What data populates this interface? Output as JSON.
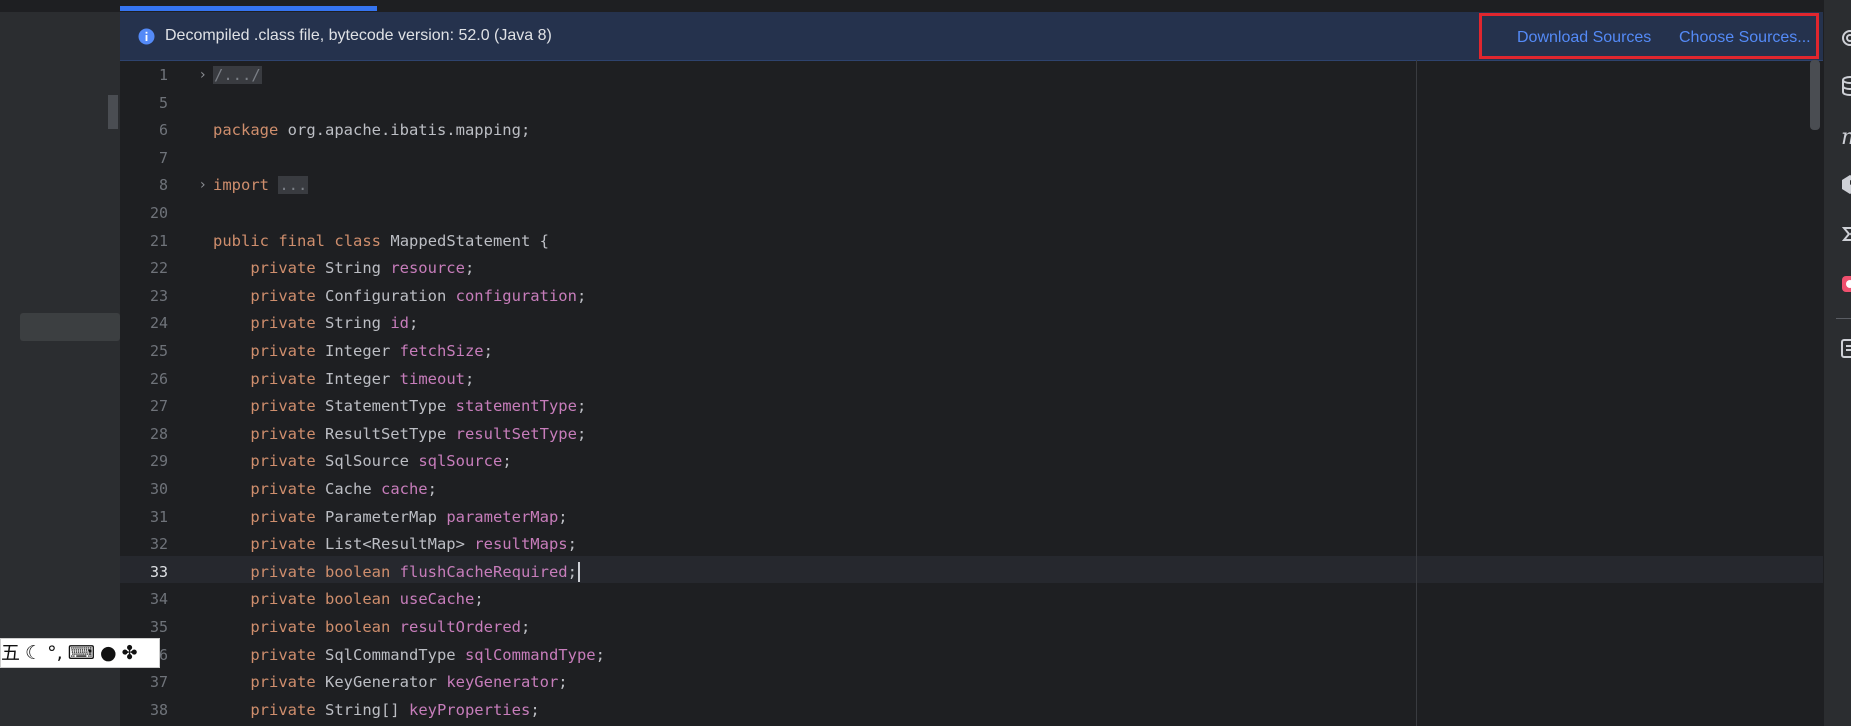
{
  "notification": {
    "message": "Decompiled .class file, bytecode version: 52.0 (Java 8)",
    "download_sources": "Download Sources",
    "choose_sources": "Choose Sources..."
  },
  "editor": {
    "current_line": "33",
    "lines": [
      {
        "n": "1",
        "fold": true,
        "tokens": [
          {
            "t": "/.../",
            "c": "fold-ph"
          }
        ]
      },
      {
        "n": "5",
        "tokens": []
      },
      {
        "n": "6",
        "tokens": [
          {
            "t": "package",
            "c": "kw"
          },
          {
            "t": " org.apache.ibatis.mapping;",
            "c": "tp"
          }
        ]
      },
      {
        "n": "7",
        "tokens": []
      },
      {
        "n": "8",
        "fold": true,
        "tokens": [
          {
            "t": "import",
            "c": "kw"
          },
          {
            "t": " ",
            "c": "tp"
          },
          {
            "t": "...",
            "c": "fold-ph"
          }
        ]
      },
      {
        "n": "20",
        "tokens": []
      },
      {
        "n": "21",
        "tokens": [
          {
            "t": "public",
            "c": "kw"
          },
          {
            "t": " ",
            "c": "tp"
          },
          {
            "t": "final",
            "c": "kw"
          },
          {
            "t": " ",
            "c": "tp"
          },
          {
            "t": "class",
            "c": "kw"
          },
          {
            "t": " MappedStatement {",
            "c": "tp"
          }
        ]
      },
      {
        "n": "22",
        "tokens": [
          {
            "t": "    private",
            "c": "kw"
          },
          {
            "t": " String ",
            "c": "tp"
          },
          {
            "t": "resource",
            "c": "fld"
          },
          {
            "t": ";",
            "c": "tp"
          }
        ]
      },
      {
        "n": "23",
        "tokens": [
          {
            "t": "    private",
            "c": "kw"
          },
          {
            "t": " Configuration ",
            "c": "tp"
          },
          {
            "t": "configuration",
            "c": "fld"
          },
          {
            "t": ";",
            "c": "tp"
          }
        ]
      },
      {
        "n": "24",
        "tokens": [
          {
            "t": "    private",
            "c": "kw"
          },
          {
            "t": " String ",
            "c": "tp"
          },
          {
            "t": "id",
            "c": "fld"
          },
          {
            "t": ";",
            "c": "tp"
          }
        ]
      },
      {
        "n": "25",
        "tokens": [
          {
            "t": "    private",
            "c": "kw"
          },
          {
            "t": " Integer ",
            "c": "tp"
          },
          {
            "t": "fetchSize",
            "c": "fld"
          },
          {
            "t": ";",
            "c": "tp"
          }
        ]
      },
      {
        "n": "26",
        "tokens": [
          {
            "t": "    private",
            "c": "kw"
          },
          {
            "t": " Integer ",
            "c": "tp"
          },
          {
            "t": "timeout",
            "c": "fld"
          },
          {
            "t": ";",
            "c": "tp"
          }
        ]
      },
      {
        "n": "27",
        "tokens": [
          {
            "t": "    private",
            "c": "kw"
          },
          {
            "t": " StatementType ",
            "c": "tp"
          },
          {
            "t": "statementType",
            "c": "fld"
          },
          {
            "t": ";",
            "c": "tp"
          }
        ]
      },
      {
        "n": "28",
        "tokens": [
          {
            "t": "    private",
            "c": "kw"
          },
          {
            "t": " ResultSetType ",
            "c": "tp"
          },
          {
            "t": "resultSetType",
            "c": "fld"
          },
          {
            "t": ";",
            "c": "tp"
          }
        ]
      },
      {
        "n": "29",
        "tokens": [
          {
            "t": "    private",
            "c": "kw"
          },
          {
            "t": " SqlSource ",
            "c": "tp"
          },
          {
            "t": "sqlSource",
            "c": "fld"
          },
          {
            "t": ";",
            "c": "tp"
          }
        ]
      },
      {
        "n": "30",
        "tokens": [
          {
            "t": "    private",
            "c": "kw"
          },
          {
            "t": " Cache ",
            "c": "tp"
          },
          {
            "t": "cache",
            "c": "fld"
          },
          {
            "t": ";",
            "c": "tp"
          }
        ]
      },
      {
        "n": "31",
        "tokens": [
          {
            "t": "    private",
            "c": "kw"
          },
          {
            "t": " ParameterMap ",
            "c": "tp"
          },
          {
            "t": "parameterMap",
            "c": "fld"
          },
          {
            "t": ";",
            "c": "tp"
          }
        ]
      },
      {
        "n": "32",
        "tokens": [
          {
            "t": "    private",
            "c": "kw"
          },
          {
            "t": " List<ResultMap> ",
            "c": "tp"
          },
          {
            "t": "resultMaps",
            "c": "fld"
          },
          {
            "t": ";",
            "c": "tp"
          }
        ]
      },
      {
        "n": "33",
        "caret": true,
        "tokens": [
          {
            "t": "    private",
            "c": "kw"
          },
          {
            "t": " ",
            "c": "tp"
          },
          {
            "t": "boolean",
            "c": "kw"
          },
          {
            "t": " ",
            "c": "tp"
          },
          {
            "t": "flushCacheRequired",
            "c": "fld"
          },
          {
            "t": ";",
            "c": "tp"
          }
        ]
      },
      {
        "n": "34",
        "tokens": [
          {
            "t": "    private",
            "c": "kw"
          },
          {
            "t": " ",
            "c": "tp"
          },
          {
            "t": "boolean",
            "c": "kw"
          },
          {
            "t": " ",
            "c": "tp"
          },
          {
            "t": "useCache",
            "c": "fld"
          },
          {
            "t": ";",
            "c": "tp"
          }
        ]
      },
      {
        "n": "35",
        "tokens": [
          {
            "t": "    private",
            "c": "kw"
          },
          {
            "t": " ",
            "c": "tp"
          },
          {
            "t": "boolean",
            "c": "kw"
          },
          {
            "t": " ",
            "c": "tp"
          },
          {
            "t": "resultOrdered",
            "c": "fld"
          },
          {
            "t": ";",
            "c": "tp"
          }
        ]
      },
      {
        "n": "36",
        "tokens": [
          {
            "t": "    private",
            "c": "kw"
          },
          {
            "t": " SqlCommandType ",
            "c": "tp"
          },
          {
            "t": "sqlCommandType",
            "c": "fld"
          },
          {
            "t": ";",
            "c": "tp"
          }
        ]
      },
      {
        "n": "37",
        "tokens": [
          {
            "t": "    private",
            "c": "kw"
          },
          {
            "t": " KeyGenerator ",
            "c": "tp"
          },
          {
            "t": "keyGenerator",
            "c": "fld"
          },
          {
            "t": ";",
            "c": "tp"
          }
        ]
      },
      {
        "n": "38",
        "tokens": [
          {
            "t": "    private",
            "c": "kw"
          },
          {
            "t": " String[] ",
            "c": "tp"
          },
          {
            "t": "keyProperties",
            "c": "fld"
          },
          {
            "t": ";",
            "c": "tp"
          }
        ]
      }
    ]
  },
  "right_toolbar": {
    "icons": [
      "notifications-icon",
      "database-icon",
      "maven-icon",
      "gradle-icon",
      "ai-assistant-icon",
      "plugin-icon",
      "event-log-icon"
    ]
  },
  "ime_toolbar": {
    "glyphs": [
      {
        "name": "ime-mode-wubi",
        "glyph": "五"
      },
      {
        "name": "ime-moon-icon",
        "glyph": "☾"
      },
      {
        "name": "ime-punctuation-icon",
        "glyph": "°,"
      },
      {
        "name": "ime-keyboard-icon",
        "glyph": "⌨"
      },
      {
        "name": "ime-user-icon",
        "glyph": "●"
      },
      {
        "name": "ime-apps-icon",
        "glyph": "✤"
      }
    ]
  },
  "colors": {
    "keyword": "#cf8e6d",
    "field": "#c77dbb",
    "text": "#bcbec4",
    "link": "#548af7",
    "highlight_border": "#e0262e",
    "notification_bg": "#25324d"
  }
}
